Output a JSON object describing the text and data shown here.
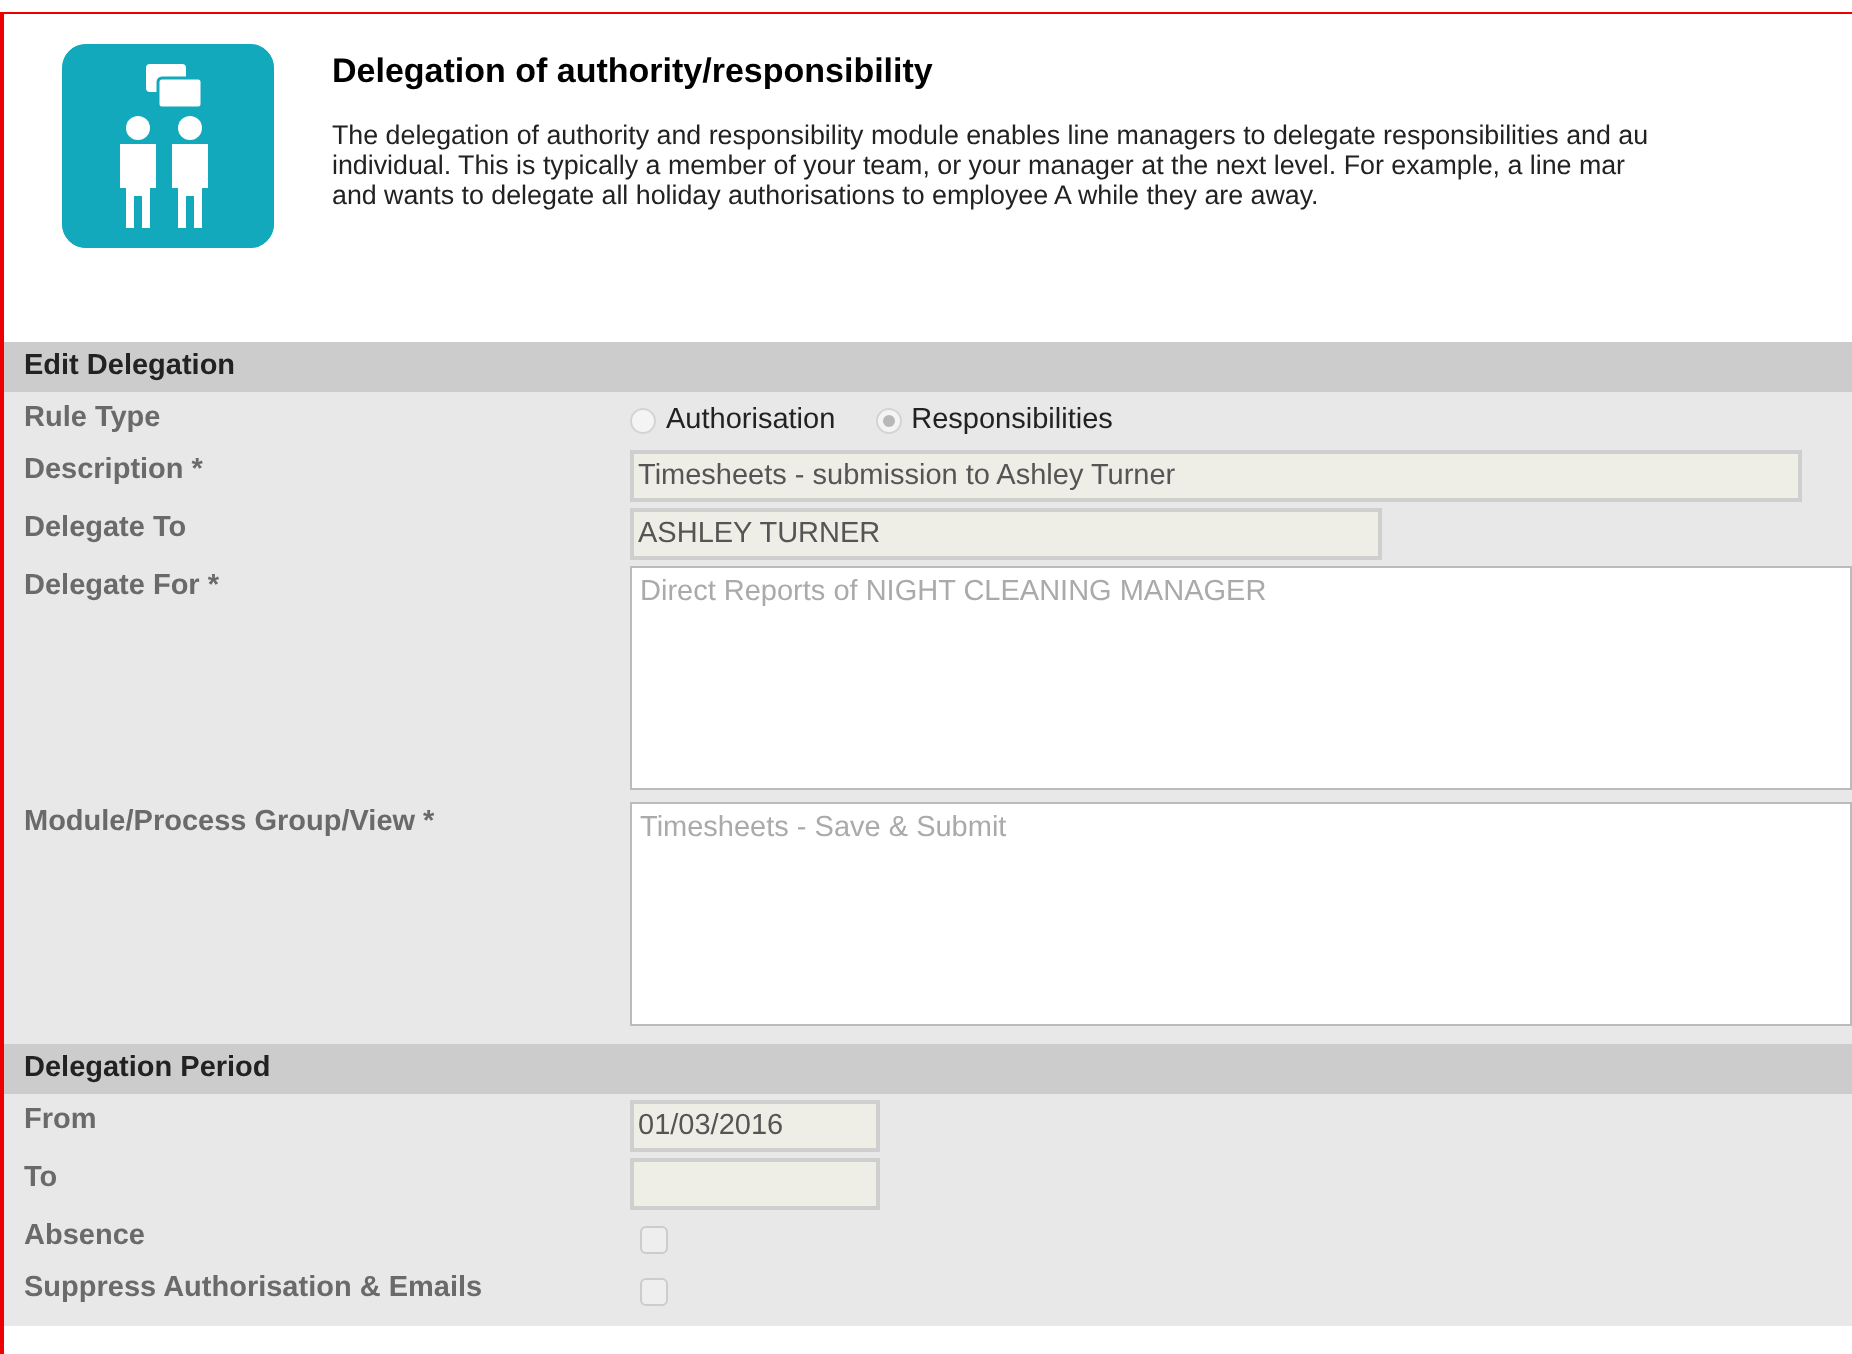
{
  "header": {
    "title": "Delegation of authority/responsibility",
    "description_lines": [
      "The delegation of authority and responsibility module enables line managers to delegate responsibilities and au",
      "individual. This is typically a member of your team, or your manager at the next level. For example, a line mar",
      "and wants to delegate all holiday authorisations to employee A while they are away."
    ]
  },
  "sections": [
    {
      "title": "Edit Delegation",
      "rows": [
        {
          "label": "Rule Type",
          "kind": "radio",
          "options": [
            {
              "label": "Authorisation",
              "selected": false
            },
            {
              "label": "Responsibilities",
              "selected": true
            }
          ]
        },
        {
          "label": "Description *",
          "kind": "longtext",
          "value": "Timesheets - submission to Ashley Turner"
        },
        {
          "label": "Delegate To",
          "kind": "text",
          "value": "ASHLEY TURNER"
        },
        {
          "label": "Delegate For *",
          "kind": "textarea",
          "value": "Direct Reports of NIGHT CLEANING MANAGER"
        },
        {
          "label": "Module/Process Group/View *",
          "kind": "textarea",
          "value": "Timesheets - Save & Submit"
        }
      ]
    },
    {
      "title": "Delegation Period",
      "rows": [
        {
          "label": "From",
          "kind": "date",
          "value": "01/03/2016"
        },
        {
          "label": "To",
          "kind": "date",
          "value": ""
        },
        {
          "label": "Absence",
          "kind": "checkbox",
          "checked": false
        },
        {
          "label": "Suppress Authorisation & Emails",
          "kind": "checkbox",
          "checked": false
        }
      ]
    }
  ]
}
